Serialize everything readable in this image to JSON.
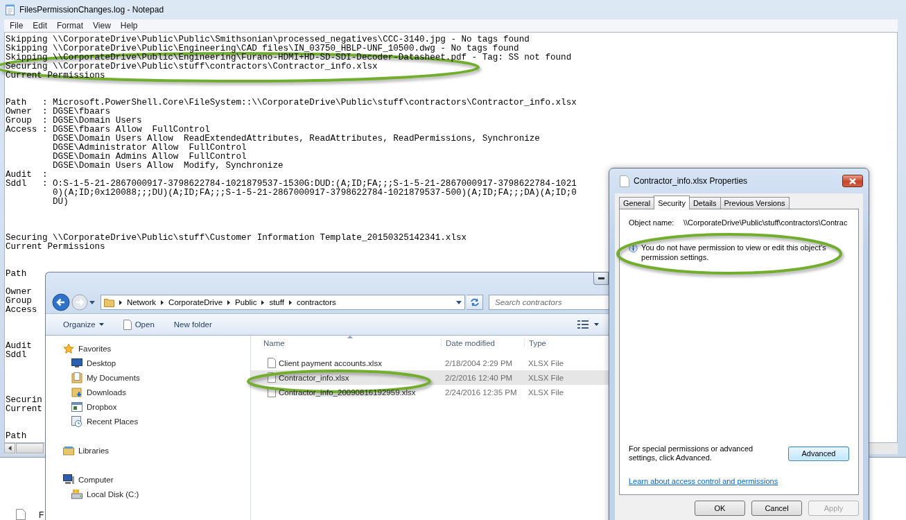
{
  "notepad": {
    "title": "FilesPermissionChanges.log - Notepad",
    "menu": [
      "File",
      "Edit",
      "Format",
      "View",
      "Help"
    ],
    "lines": [
      {
        "kind": "text",
        "text": "Skipping \\\\CorporateDrive\\Public\\Public\\Smithsonian\\processed_negatives\\CCC-3140.jpg - No tags found"
      },
      {
        "kind": "text",
        "text": "Skipping \\\\CorporateDrive\\Public\\Engineering\\CAD files\\IN_03750_HBLP-UNF_10500.dwg - No tags found"
      },
      {
        "kind": "text",
        "text": "Skipping \\\\CorporateDrive\\Public\\Engineering\\Furano-HDMI+HD-SD-SDI-Decoder-Datasheet.pdf - Tag: SS not found"
      },
      {
        "kind": "text",
        "text": "Securing \\\\CorporateDrive\\Public\\stuff\\contractors\\Contractor_info.xlsx"
      },
      {
        "kind": "text",
        "text": "Current Permissions"
      },
      {
        "kind": "blank"
      },
      {
        "kind": "blank"
      },
      {
        "kind": "text",
        "text": "Path   : Microsoft.PowerShell.Core\\FileSystem::\\\\CorporateDrive\\Public\\stuff\\contractors\\Contractor_info.xlsx"
      },
      {
        "kind": "text",
        "text": "Owner  : DGSE\\fbaars"
      },
      {
        "kind": "text",
        "text": "Group  : DGSE\\Domain Users"
      },
      {
        "kind": "text",
        "text": "Access : DGSE\\fbaars Allow  FullControl"
      },
      {
        "kind": "text",
        "text": "         DGSE\\Domain Users Allow  ReadExtendedAttributes, ReadAttributes, ReadPermissions, Synchronize"
      },
      {
        "kind": "text",
        "text": "         DGSE\\Administrator Allow  FullControl"
      },
      {
        "kind": "text",
        "text": "         DGSE\\Domain Admins Allow  FullControl"
      },
      {
        "kind": "text",
        "text": "         DGSE\\Domain Users Allow  Modify, Synchronize"
      },
      {
        "kind": "text",
        "text": "Audit  :"
      },
      {
        "kind": "text",
        "text": "Sddl   : O:S-1-5-21-2867000917-3798622784-1021879537-1530G:DUD:(A;ID;FA;;;S-1-5-21-2867000917-3798622784-1021"
      },
      {
        "kind": "text",
        "text": "         0)(A;ID;0x120088;;;DU)(A;ID;FA;;;S-1-5-21-2867000917-3798622784-1021879537-500)(A;ID;FA;;;DA)(A;ID;0"
      },
      {
        "kind": "text",
        "text": "         DU)"
      },
      {
        "kind": "blank"
      },
      {
        "kind": "blank"
      },
      {
        "kind": "blank"
      },
      {
        "kind": "text",
        "text": "Securing \\\\CorporateDrive\\Public\\stuff\\Customer Information Template_20150325142341.xlsx"
      },
      {
        "kind": "text",
        "text": "Current Permissions"
      },
      {
        "kind": "blank"
      },
      {
        "kind": "blank"
      },
      {
        "kind": "text",
        "text": "Path"
      },
      {
        "kind": "blank"
      },
      {
        "kind": "text",
        "text": "Owner"
      },
      {
        "kind": "text",
        "text": "Group"
      },
      {
        "kind": "text",
        "text": "Access"
      },
      {
        "kind": "blank"
      },
      {
        "kind": "blank"
      },
      {
        "kind": "blank"
      },
      {
        "kind": "text",
        "text": "Audit"
      },
      {
        "kind": "text",
        "text": "Sddl"
      },
      {
        "kind": "blank"
      },
      {
        "kind": "blank"
      },
      {
        "kind": "blank"
      },
      {
        "kind": "blank"
      },
      {
        "kind": "text",
        "text": "Securin"
      },
      {
        "kind": "text",
        "text": "Current"
      },
      {
        "kind": "blank"
      },
      {
        "kind": "blank"
      },
      {
        "kind": "text",
        "text": "Path"
      }
    ]
  },
  "explorer": {
    "breadcrumb": [
      "Network",
      "CorporateDrive",
      "Public",
      "stuff",
      "contractors"
    ],
    "search": {
      "placeholder": "Search contractors"
    },
    "organize": "Organize",
    "open": "Open",
    "new_folder": "New folder",
    "nav": [
      {
        "label": "Favorites",
        "kind": "star",
        "children": [
          {
            "label": "Desktop",
            "kind": "desktop"
          },
          {
            "label": "My Documents",
            "kind": "documents"
          },
          {
            "label": "Downloads",
            "kind": "downloads"
          },
          {
            "label": "Dropbox",
            "kind": "dropbox"
          },
          {
            "label": "Recent Places",
            "kind": "recent"
          }
        ]
      },
      {
        "label": "Libraries",
        "kind": "libraries"
      },
      {
        "label": "Computer",
        "kind": "computer",
        "children": [
          {
            "label": "Local Disk (C:)",
            "kind": "disk"
          }
        ]
      }
    ],
    "columns": [
      "Name",
      "Date modified",
      "Type"
    ],
    "files": [
      {
        "name": "Client payment accounts.xlsx",
        "date": "2/18/2004 2:29 PM",
        "type": "XLSX File",
        "selected": false
      },
      {
        "name": "Contractor_info.xlsx",
        "date": "2/2/2016 12:40 PM",
        "type": "XLSX File",
        "selected": true
      },
      {
        "name": "Contractor_info_20090816192959.xlsx",
        "date": "2/24/2016 12:35 PM",
        "type": "XLSX File",
        "selected": false
      }
    ]
  },
  "dialog": {
    "title": "Contractor_info.xlsx Properties",
    "tabs": [
      {
        "label": "General",
        "selected": false
      },
      {
        "label": "Security",
        "selected": true
      },
      {
        "label": "Details",
        "selected": false
      },
      {
        "label": "Previous Versions",
        "selected": false
      }
    ],
    "object_name_label": "Object name:",
    "object_name": "\\\\CorporateDrive\\Public\\stuff\\contractors\\Contrac",
    "message": "You do not have permission to view or edit this object’s permission settings.",
    "advanced_text": "For special permissions or advanced settings, click Advanced.",
    "advanced_button": "Advanced",
    "link": "Learn about access control and permissions",
    "buttons": [
      {
        "label": "OK",
        "disabled": false
      },
      {
        "label": "Cancel",
        "disabled": false
      },
      {
        "label": "Apply",
        "disabled": true
      }
    ]
  },
  "taskbar": {
    "label": "F"
  }
}
